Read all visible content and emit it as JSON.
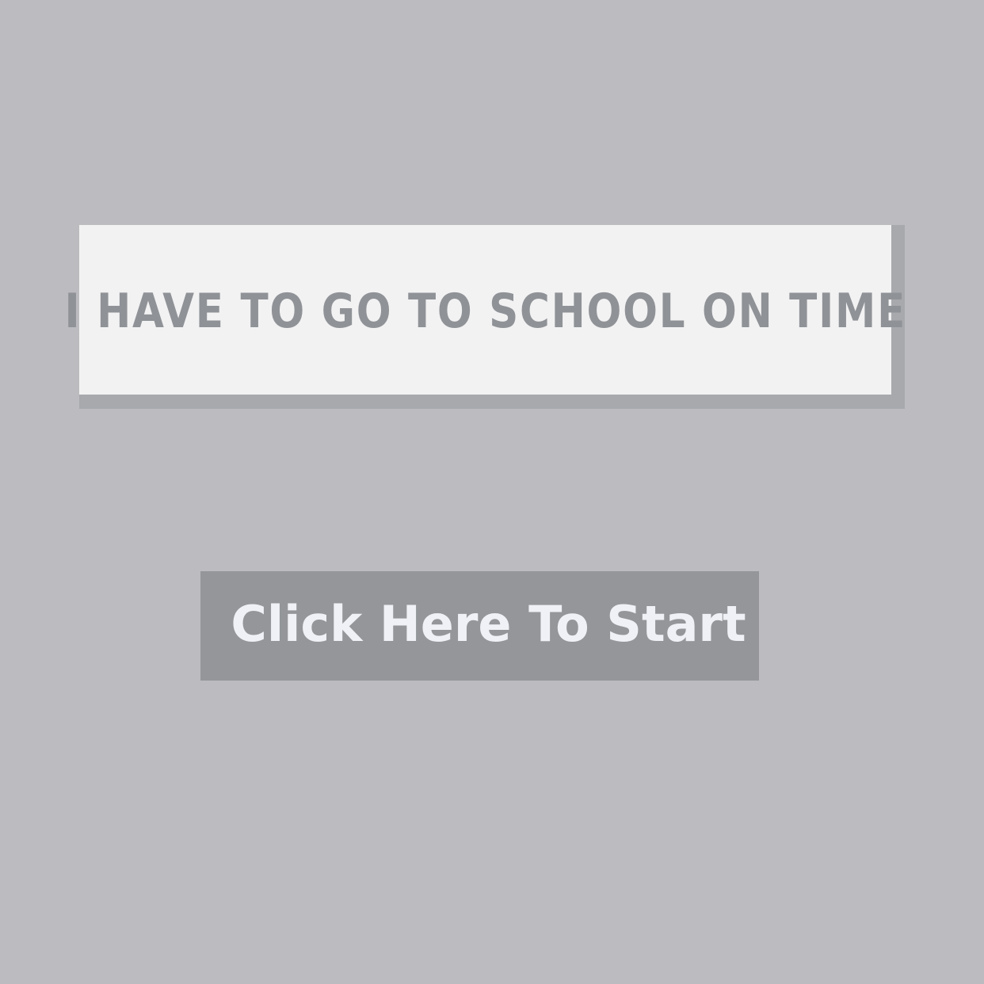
{
  "title": {
    "text": "I HAVE TO GO TO SCHOOL ON TIME"
  },
  "start": {
    "label": "Click Here To Start"
  },
  "colors": {
    "background": "#bcbcc0",
    "panel": "#f2f2f3",
    "panel_shadow": "#a7a9ad",
    "title_text": "#8f9296",
    "button": "#949699",
    "button_text": "#f0f1f6"
  }
}
